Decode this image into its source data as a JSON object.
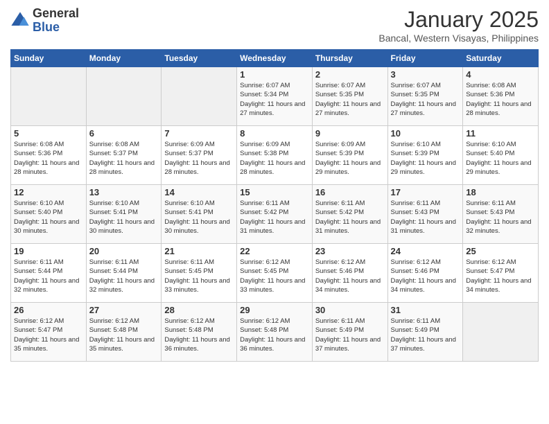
{
  "logo": {
    "general": "General",
    "blue": "Blue"
  },
  "title": "January 2025",
  "location": "Bancal, Western Visayas, Philippines",
  "days_of_week": [
    "Sunday",
    "Monday",
    "Tuesday",
    "Wednesday",
    "Thursday",
    "Friday",
    "Saturday"
  ],
  "weeks": [
    [
      {
        "num": "",
        "info": ""
      },
      {
        "num": "",
        "info": ""
      },
      {
        "num": "",
        "info": ""
      },
      {
        "num": "1",
        "info": "Sunrise: 6:07 AM\nSunset: 5:34 PM\nDaylight: 11 hours and 27 minutes."
      },
      {
        "num": "2",
        "info": "Sunrise: 6:07 AM\nSunset: 5:35 PM\nDaylight: 11 hours and 27 minutes."
      },
      {
        "num": "3",
        "info": "Sunrise: 6:07 AM\nSunset: 5:35 PM\nDaylight: 11 hours and 27 minutes."
      },
      {
        "num": "4",
        "info": "Sunrise: 6:08 AM\nSunset: 5:36 PM\nDaylight: 11 hours and 28 minutes."
      }
    ],
    [
      {
        "num": "5",
        "info": "Sunrise: 6:08 AM\nSunset: 5:36 PM\nDaylight: 11 hours and 28 minutes."
      },
      {
        "num": "6",
        "info": "Sunrise: 6:08 AM\nSunset: 5:37 PM\nDaylight: 11 hours and 28 minutes."
      },
      {
        "num": "7",
        "info": "Sunrise: 6:09 AM\nSunset: 5:37 PM\nDaylight: 11 hours and 28 minutes."
      },
      {
        "num": "8",
        "info": "Sunrise: 6:09 AM\nSunset: 5:38 PM\nDaylight: 11 hours and 28 minutes."
      },
      {
        "num": "9",
        "info": "Sunrise: 6:09 AM\nSunset: 5:39 PM\nDaylight: 11 hours and 29 minutes."
      },
      {
        "num": "10",
        "info": "Sunrise: 6:10 AM\nSunset: 5:39 PM\nDaylight: 11 hours and 29 minutes."
      },
      {
        "num": "11",
        "info": "Sunrise: 6:10 AM\nSunset: 5:40 PM\nDaylight: 11 hours and 29 minutes."
      }
    ],
    [
      {
        "num": "12",
        "info": "Sunrise: 6:10 AM\nSunset: 5:40 PM\nDaylight: 11 hours and 30 minutes."
      },
      {
        "num": "13",
        "info": "Sunrise: 6:10 AM\nSunset: 5:41 PM\nDaylight: 11 hours and 30 minutes."
      },
      {
        "num": "14",
        "info": "Sunrise: 6:10 AM\nSunset: 5:41 PM\nDaylight: 11 hours and 30 minutes."
      },
      {
        "num": "15",
        "info": "Sunrise: 6:11 AM\nSunset: 5:42 PM\nDaylight: 11 hours and 31 minutes."
      },
      {
        "num": "16",
        "info": "Sunrise: 6:11 AM\nSunset: 5:42 PM\nDaylight: 11 hours and 31 minutes."
      },
      {
        "num": "17",
        "info": "Sunrise: 6:11 AM\nSunset: 5:43 PM\nDaylight: 11 hours and 31 minutes."
      },
      {
        "num": "18",
        "info": "Sunrise: 6:11 AM\nSunset: 5:43 PM\nDaylight: 11 hours and 32 minutes."
      }
    ],
    [
      {
        "num": "19",
        "info": "Sunrise: 6:11 AM\nSunset: 5:44 PM\nDaylight: 11 hours and 32 minutes."
      },
      {
        "num": "20",
        "info": "Sunrise: 6:11 AM\nSunset: 5:44 PM\nDaylight: 11 hours and 32 minutes."
      },
      {
        "num": "21",
        "info": "Sunrise: 6:11 AM\nSunset: 5:45 PM\nDaylight: 11 hours and 33 minutes."
      },
      {
        "num": "22",
        "info": "Sunrise: 6:12 AM\nSunset: 5:45 PM\nDaylight: 11 hours and 33 minutes."
      },
      {
        "num": "23",
        "info": "Sunrise: 6:12 AM\nSunset: 5:46 PM\nDaylight: 11 hours and 34 minutes."
      },
      {
        "num": "24",
        "info": "Sunrise: 6:12 AM\nSunset: 5:46 PM\nDaylight: 11 hours and 34 minutes."
      },
      {
        "num": "25",
        "info": "Sunrise: 6:12 AM\nSunset: 5:47 PM\nDaylight: 11 hours and 34 minutes."
      }
    ],
    [
      {
        "num": "26",
        "info": "Sunrise: 6:12 AM\nSunset: 5:47 PM\nDaylight: 11 hours and 35 minutes."
      },
      {
        "num": "27",
        "info": "Sunrise: 6:12 AM\nSunset: 5:48 PM\nDaylight: 11 hours and 35 minutes."
      },
      {
        "num": "28",
        "info": "Sunrise: 6:12 AM\nSunset: 5:48 PM\nDaylight: 11 hours and 36 minutes."
      },
      {
        "num": "29",
        "info": "Sunrise: 6:12 AM\nSunset: 5:48 PM\nDaylight: 11 hours and 36 minutes."
      },
      {
        "num": "30",
        "info": "Sunrise: 6:11 AM\nSunset: 5:49 PM\nDaylight: 11 hours and 37 minutes."
      },
      {
        "num": "31",
        "info": "Sunrise: 6:11 AM\nSunset: 5:49 PM\nDaylight: 11 hours and 37 minutes."
      },
      {
        "num": "",
        "info": ""
      }
    ]
  ]
}
